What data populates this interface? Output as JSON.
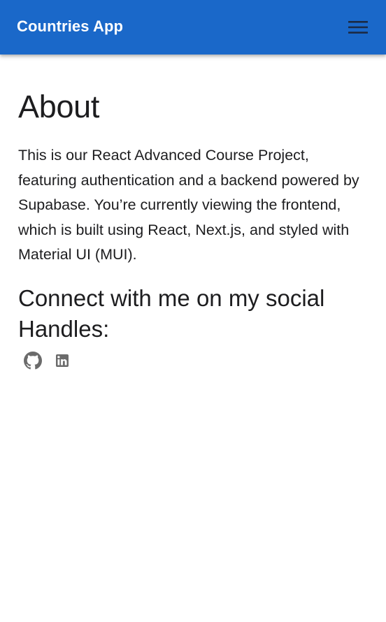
{
  "header": {
    "title": "Countries App",
    "menu_icon": "hamburger-menu-icon",
    "background_color": "#1a68c9",
    "text_color": "#ffffff"
  },
  "main": {
    "title": "About",
    "description": "This is our React Advanced Course Project, featuring authentication and a backend powered by Supabase. You’re currently viewing the frontend, which is built using React, Next.js, and styled with Material UI (MUI).",
    "social_heading": "Connect with me on my social Handles:",
    "social_links": [
      {
        "icon": "github-icon",
        "name": "GitHub"
      },
      {
        "icon": "linkedin-icon",
        "name": "LinkedIn"
      }
    ],
    "icon_color": "#6b6b6b"
  }
}
